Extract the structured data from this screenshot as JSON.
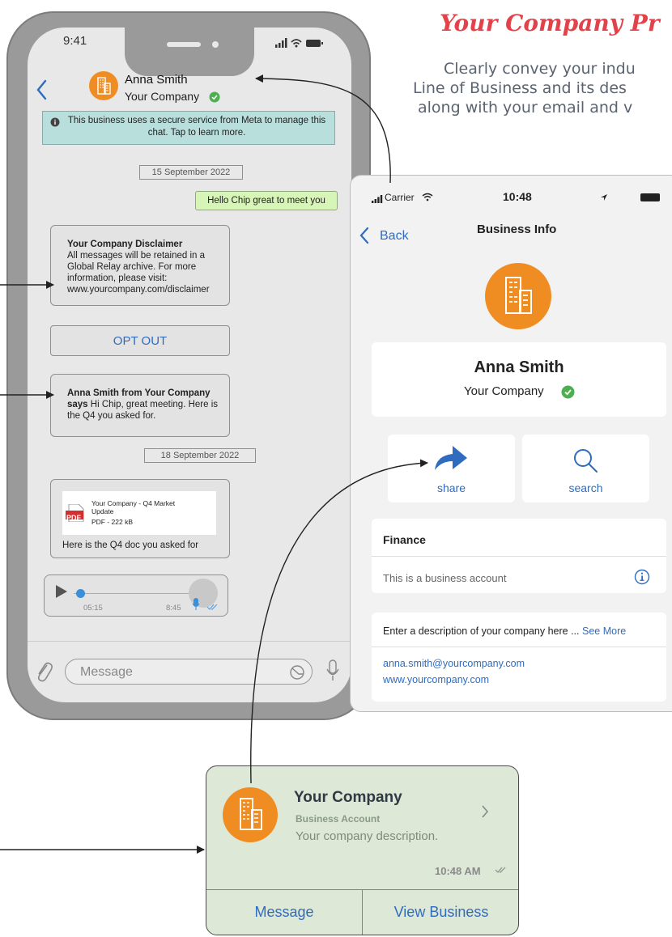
{
  "heading": {
    "title": "Your Company Pr",
    "line1": "Clearly convey your indu",
    "line2": "Line of Business and its des",
    "line3": "along with your email and v"
  },
  "phone": {
    "time": "9:41",
    "contact_name": "Anna Smith",
    "contact_company": "Your Company",
    "notice": "This business uses a secure service from Meta to manage this chat. Tap to learn more.",
    "date1": "15 September 2022",
    "outgoing": "Hello Chip great to meet you",
    "disclaimer_title": "Your Company Disclaimer",
    "disclaimer_body": "All messages will be retained in a Global Relay archive. For more information, please visit: www.yourcompany.com/disclaimer",
    "opt_out": "OPT OUT",
    "msg_bold": "Anna Smith from Your Company says",
    "msg_rest": " Hi Chip, great meeting. Here is the Q4 you asked for.",
    "date2": "18 September 2022",
    "doc_title": "Your Company - Q4 Market Update",
    "doc_meta": "PDF - 222 kB",
    "doc_badge": "PDF",
    "doc_caption": "Here is the Q4 doc you asked for",
    "voice_elapsed": "05:15",
    "voice_time": "8:45",
    "voice_progress": 0.05,
    "input_placeholder": "Message"
  },
  "business_info": {
    "carrier": "Carrier",
    "time": "10:48",
    "back": "Back",
    "title": "Business Info",
    "name": "Anna Smith",
    "company": "Your Company",
    "share": "share",
    "search": "search",
    "category": "Finance",
    "account_type": "This is a business account",
    "description": "Enter a description of your company here ...",
    "see_more": "See More",
    "email": "anna.smith@yourcompany.com",
    "website": "www.yourcompany.com"
  },
  "business_card": {
    "name": "Your Company",
    "subtitle": "Business Account",
    "description": "Your company description.",
    "time": "10:48 AM",
    "message_button": "Message",
    "view_button": "View Business"
  },
  "colors": {
    "accent_blue": "#2f6cc0",
    "orange": "#ef8d23",
    "verified_green": "#4caf50",
    "heading_red": "#e2434b",
    "notice_bg": "#b9dfdc",
    "outgoing_bg": "#d8f5b8",
    "card_green": "#dde8d6"
  }
}
